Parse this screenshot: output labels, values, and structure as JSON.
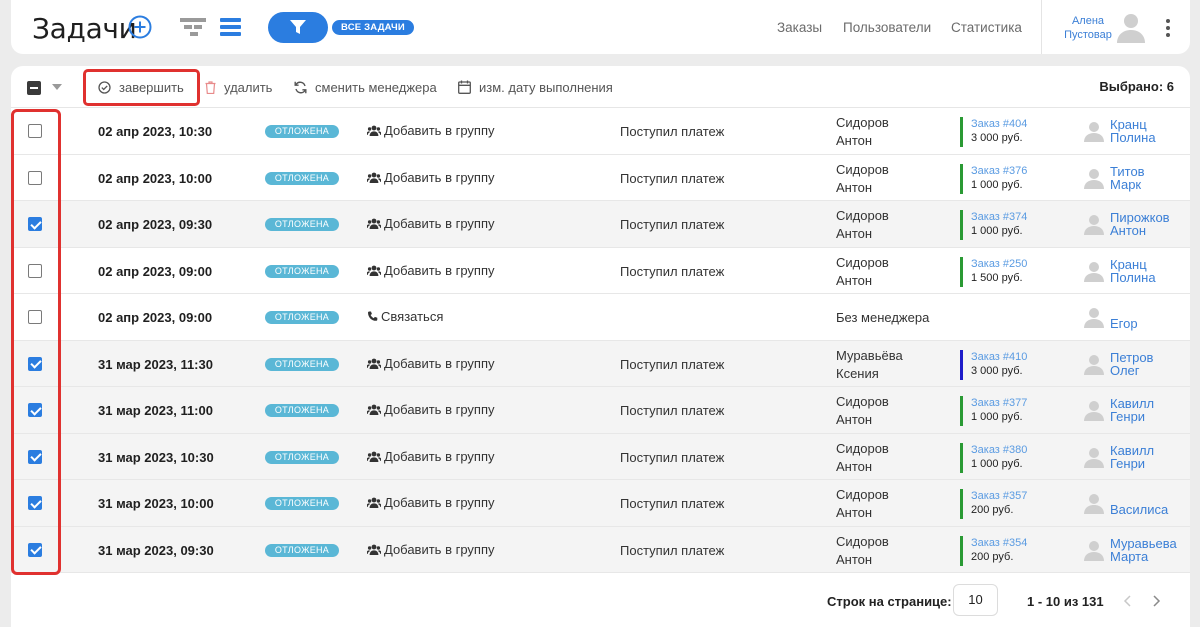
{
  "header": {
    "title": "Задачи",
    "filter_label": "ВСЕ ЗАДАЧИ",
    "nav": [
      "Заказы",
      "Пользователи",
      "Статистика"
    ],
    "user_first": "Алена",
    "user_last": "Пустовар"
  },
  "toolbar": {
    "finish": "завершить",
    "delete": "удалить",
    "change_manager": "сменить менеджера",
    "change_date": "изм. дату выполнения",
    "selected": "Выбрано: 6"
  },
  "colors": {
    "accent": "#2b7de0",
    "status": "#5ab7d6",
    "highlight": "#e0312f",
    "order_green": "#2a9a34",
    "order_blue": "#1d1cc9"
  },
  "tasks": [
    {
      "checked": false,
      "date": "02 апр 2023, 10:30",
      "status": "ОТЛОЖЕНА",
      "action_icon": "users-icon",
      "action": "Добавить в группу",
      "reason": "Поступил платеж",
      "manager": [
        "Сидоров",
        "Антон"
      ],
      "order": "Заказ #404",
      "amount": "3 000 руб.",
      "order_color": "green",
      "client": [
        "Кранц",
        "Полина"
      ]
    },
    {
      "checked": false,
      "date": "02 апр 2023, 10:00",
      "status": "ОТЛОЖЕНА",
      "action_icon": "users-icon",
      "action": "Добавить в группу",
      "reason": "Поступил платеж",
      "manager": [
        "Сидоров",
        "Антон"
      ],
      "order": "Заказ #376",
      "amount": "1 000 руб.",
      "order_color": "green",
      "client": [
        "Титов",
        "Марк"
      ]
    },
    {
      "checked": true,
      "date": "02 апр 2023, 09:30",
      "status": "ОТЛОЖЕНА",
      "action_icon": "users-icon",
      "action": "Добавить в группу",
      "reason": "Поступил платеж",
      "manager": [
        "Сидоров",
        "Антон"
      ],
      "order": "Заказ #374",
      "amount": "1 000 руб.",
      "order_color": "green",
      "client": [
        "Пирожков",
        "Антон"
      ]
    },
    {
      "checked": false,
      "date": "02 апр 2023, 09:00",
      "status": "ОТЛОЖЕНА",
      "action_icon": "users-icon",
      "action": "Добавить в группу",
      "reason": "Поступил платеж",
      "manager": [
        "Сидоров",
        "Антон"
      ],
      "order": "Заказ #250",
      "amount": "1 500 руб.",
      "order_color": "green",
      "client": [
        "Кранц",
        "Полина"
      ]
    },
    {
      "checked": false,
      "date": "02 апр 2023, 09:00",
      "status": "ОТЛОЖЕНА",
      "action_icon": "phone-icon",
      "action": "Связаться",
      "reason": "",
      "manager": [
        "Без менеджера"
      ],
      "order": "",
      "amount": "",
      "order_color": "",
      "client": [
        "Егор"
      ]
    },
    {
      "checked": true,
      "date": "31 мар 2023, 11:30",
      "status": "ОТЛОЖЕНА",
      "action_icon": "users-icon",
      "action": "Добавить в группу",
      "reason": "Поступил платеж",
      "manager": [
        "Муравьёва",
        "Ксения"
      ],
      "order": "Заказ #410",
      "amount": "3 000 руб.",
      "order_color": "blue",
      "client": [
        "Петров",
        "Олег"
      ]
    },
    {
      "checked": true,
      "date": "31 мар 2023, 11:00",
      "status": "ОТЛОЖЕНА",
      "action_icon": "users-icon",
      "action": "Добавить в группу",
      "reason": "Поступил платеж",
      "manager": [
        "Сидоров",
        "Антон"
      ],
      "order": "Заказ #377",
      "amount": "1 000 руб.",
      "order_color": "green",
      "client": [
        "Кавилл",
        "Генри"
      ]
    },
    {
      "checked": true,
      "date": "31 мар 2023, 10:30",
      "status": "ОТЛОЖЕНА",
      "action_icon": "users-icon",
      "action": "Добавить в группу",
      "reason": "Поступил платеж",
      "manager": [
        "Сидоров",
        "Антон"
      ],
      "order": "Заказ #380",
      "amount": "1 000 руб.",
      "order_color": "green",
      "client": [
        "Кавилл",
        "Генри"
      ]
    },
    {
      "checked": true,
      "date": "31 мар 2023, 10:00",
      "status": "ОТЛОЖЕНА",
      "action_icon": "users-icon",
      "action": "Добавить в группу",
      "reason": "Поступил платеж",
      "manager": [
        "Сидоров",
        "Антон"
      ],
      "order": "Заказ #357",
      "amount": "200 руб.",
      "order_color": "green",
      "client": [
        "Василиса"
      ]
    },
    {
      "checked": true,
      "date": "31 мар 2023, 09:30",
      "status": "ОТЛОЖЕНА",
      "action_icon": "users-icon",
      "action": "Добавить в группу",
      "reason": "Поступил платеж",
      "manager": [
        "Сидоров",
        "Антон"
      ],
      "order": "Заказ #354",
      "amount": "200 руб.",
      "order_color": "green",
      "client": [
        "Муравьева",
        "Марта"
      ]
    }
  ],
  "pagination": {
    "rows_label": "Строк на странице:",
    "rows_value": "10",
    "range": "1 - 10 из 131"
  }
}
